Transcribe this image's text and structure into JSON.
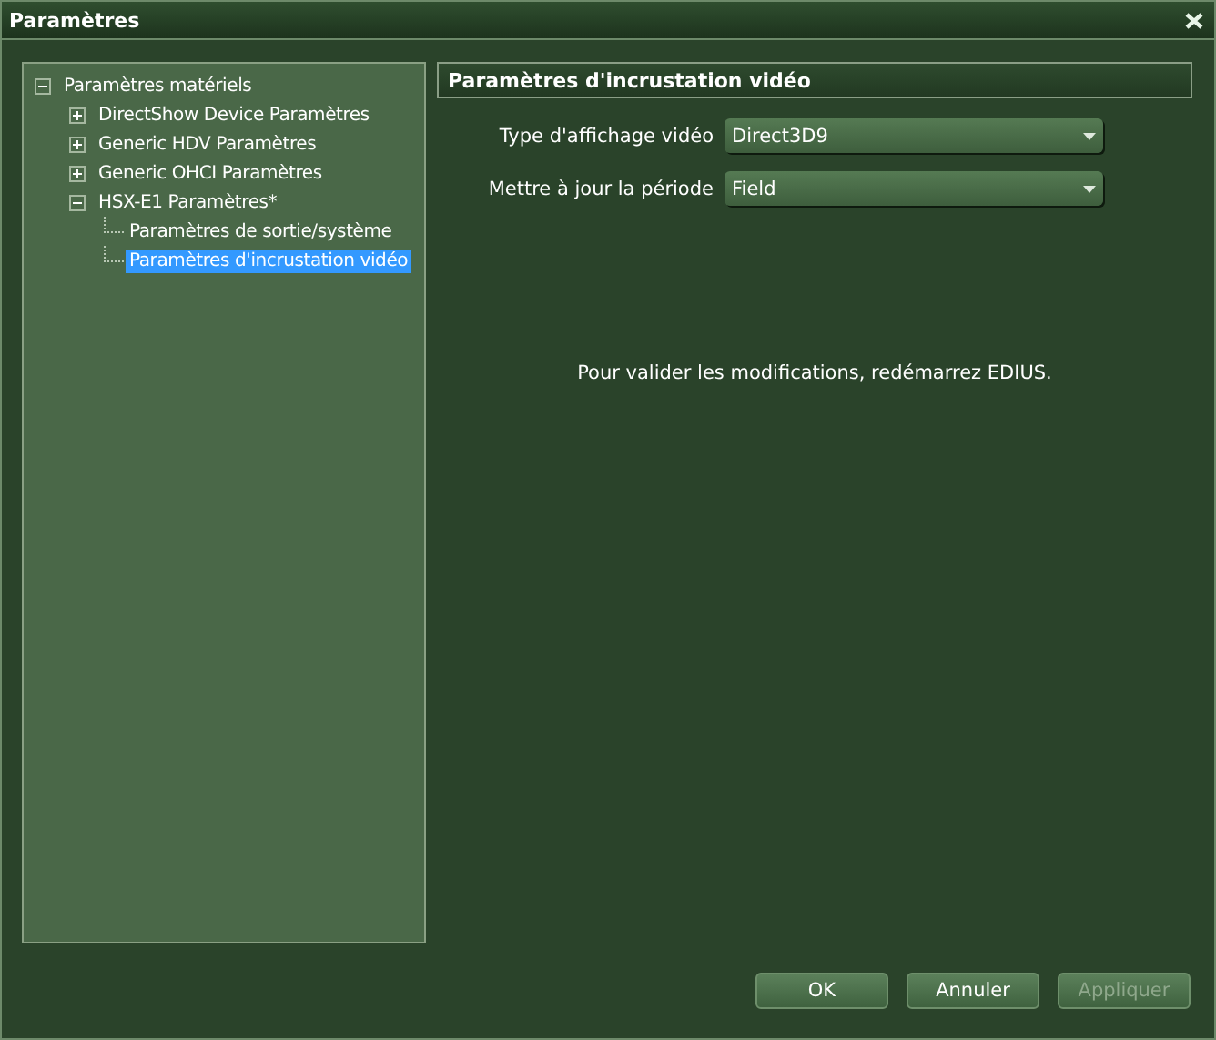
{
  "window": {
    "title": "Paramètres"
  },
  "tree": [
    {
      "label": "Paramètres matériels",
      "expanded": true,
      "selected": false,
      "children": [
        {
          "label": "DirectShow Device Paramètres",
          "expanded": false,
          "selected": false
        },
        {
          "label": "Generic HDV Paramètres",
          "expanded": false,
          "selected": false
        },
        {
          "label": "Generic OHCI Paramètres",
          "expanded": false,
          "selected": false
        },
        {
          "label": "HSX-E1 Paramètres*",
          "expanded": true,
          "selected": false,
          "children": [
            {
              "label": "Paramètres de sortie/système",
              "selected": false
            },
            {
              "label": "Paramètres d'incrustation vidéo",
              "selected": true
            }
          ]
        }
      ]
    }
  ],
  "panel": {
    "title": "Paramètres d'incrustation vidéo",
    "fields": [
      {
        "label": "Type d'affichage vidéo",
        "value": "Direct3D9"
      },
      {
        "label": "Mettre à jour la période",
        "value": "Field"
      }
    ],
    "note": "Pour valider les modifications, redémarrez EDIUS."
  },
  "buttons": [
    {
      "label": "OK",
      "disabled": false
    },
    {
      "label": "Annuler",
      "disabled": false
    },
    {
      "label": "Appliquer",
      "disabled": true
    }
  ]
}
